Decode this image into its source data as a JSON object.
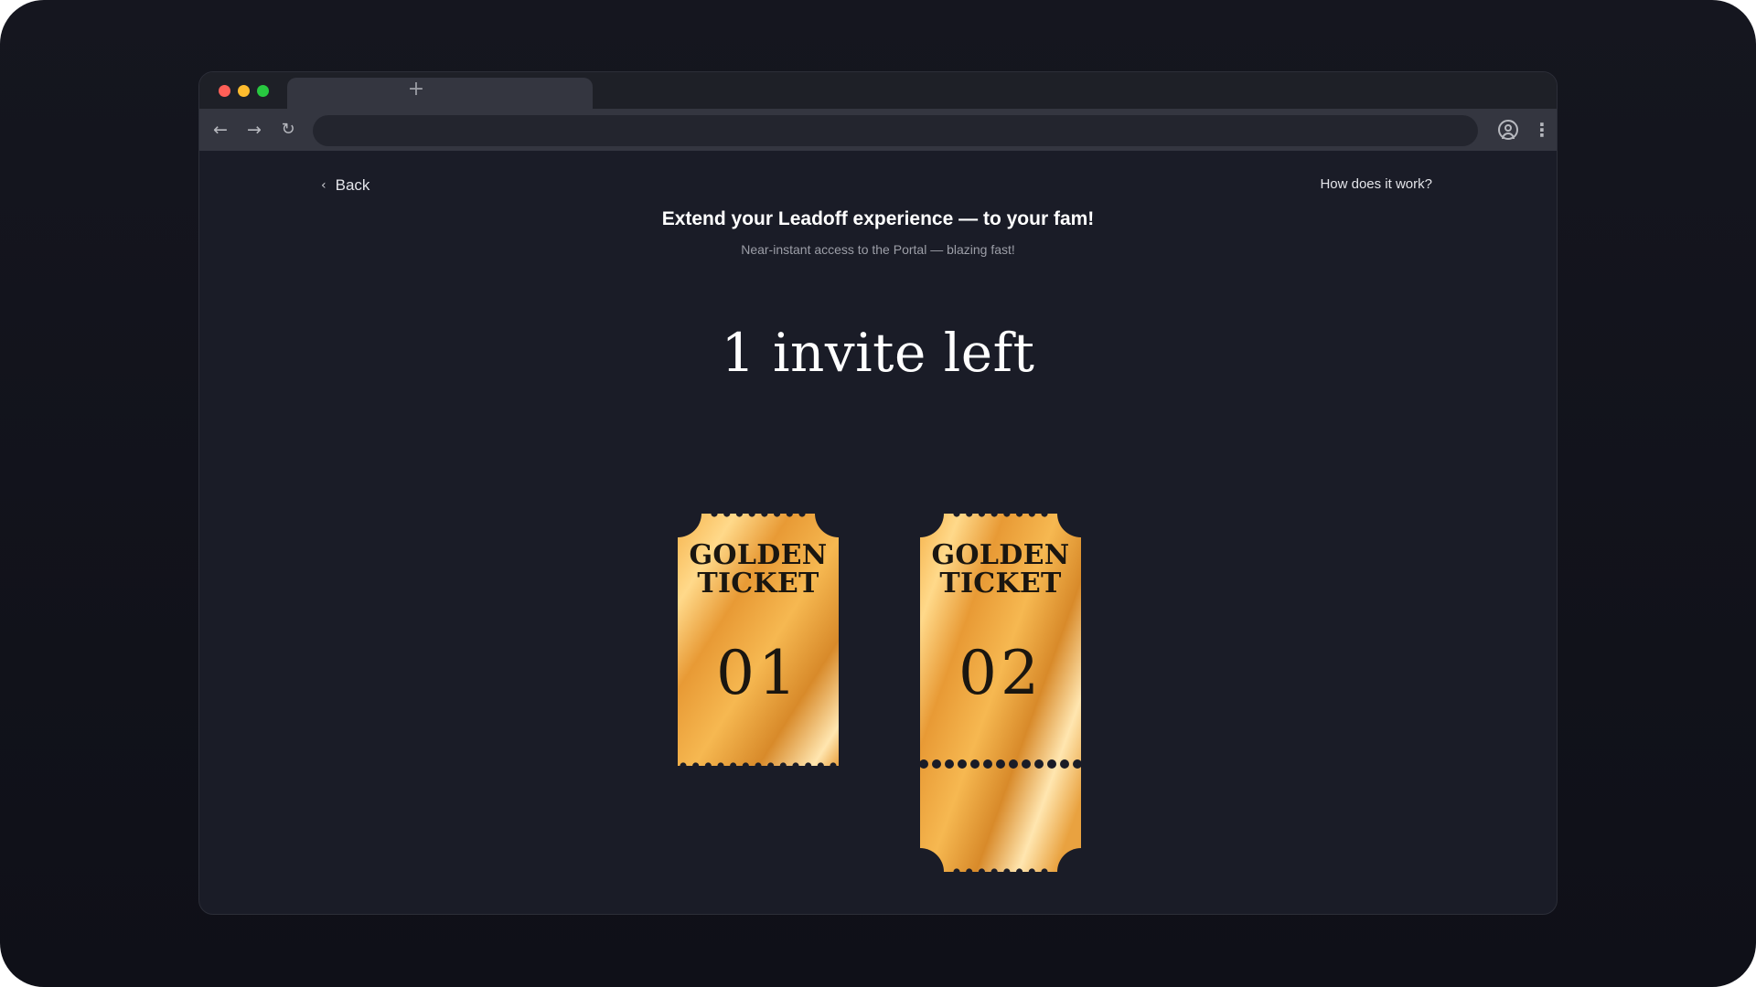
{
  "browser": {
    "new_tab_label": "+",
    "icons": {
      "back": "arrow-left-icon",
      "forward": "arrow-right-icon",
      "reload": "reload-icon",
      "profile": "user-circle-icon",
      "menu": "more-vertical-icon"
    }
  },
  "header": {
    "back_label": "Back",
    "help_link": "How does it work?"
  },
  "main": {
    "headline": "Extend your Leadoff experience — to your fam!",
    "subline": "Near-instant access to the Portal — blazing fast!",
    "invites_left": "1 invite left"
  },
  "tickets": [
    {
      "title_line1": "GOLDEN",
      "title_line2": "TICKET",
      "number": "01",
      "has_stub": false
    },
    {
      "title_line1": "GOLDEN",
      "title_line2": "TICKET",
      "number": "02",
      "has_stub": true
    }
  ],
  "colors": {
    "background": "#1a1c27",
    "gold_light": "#ffe0a0",
    "gold_mid": "#f4b24a",
    "gold_dark": "#d48a28",
    "text_primary": "#ffffff",
    "text_muted": "#9c9ea7"
  }
}
